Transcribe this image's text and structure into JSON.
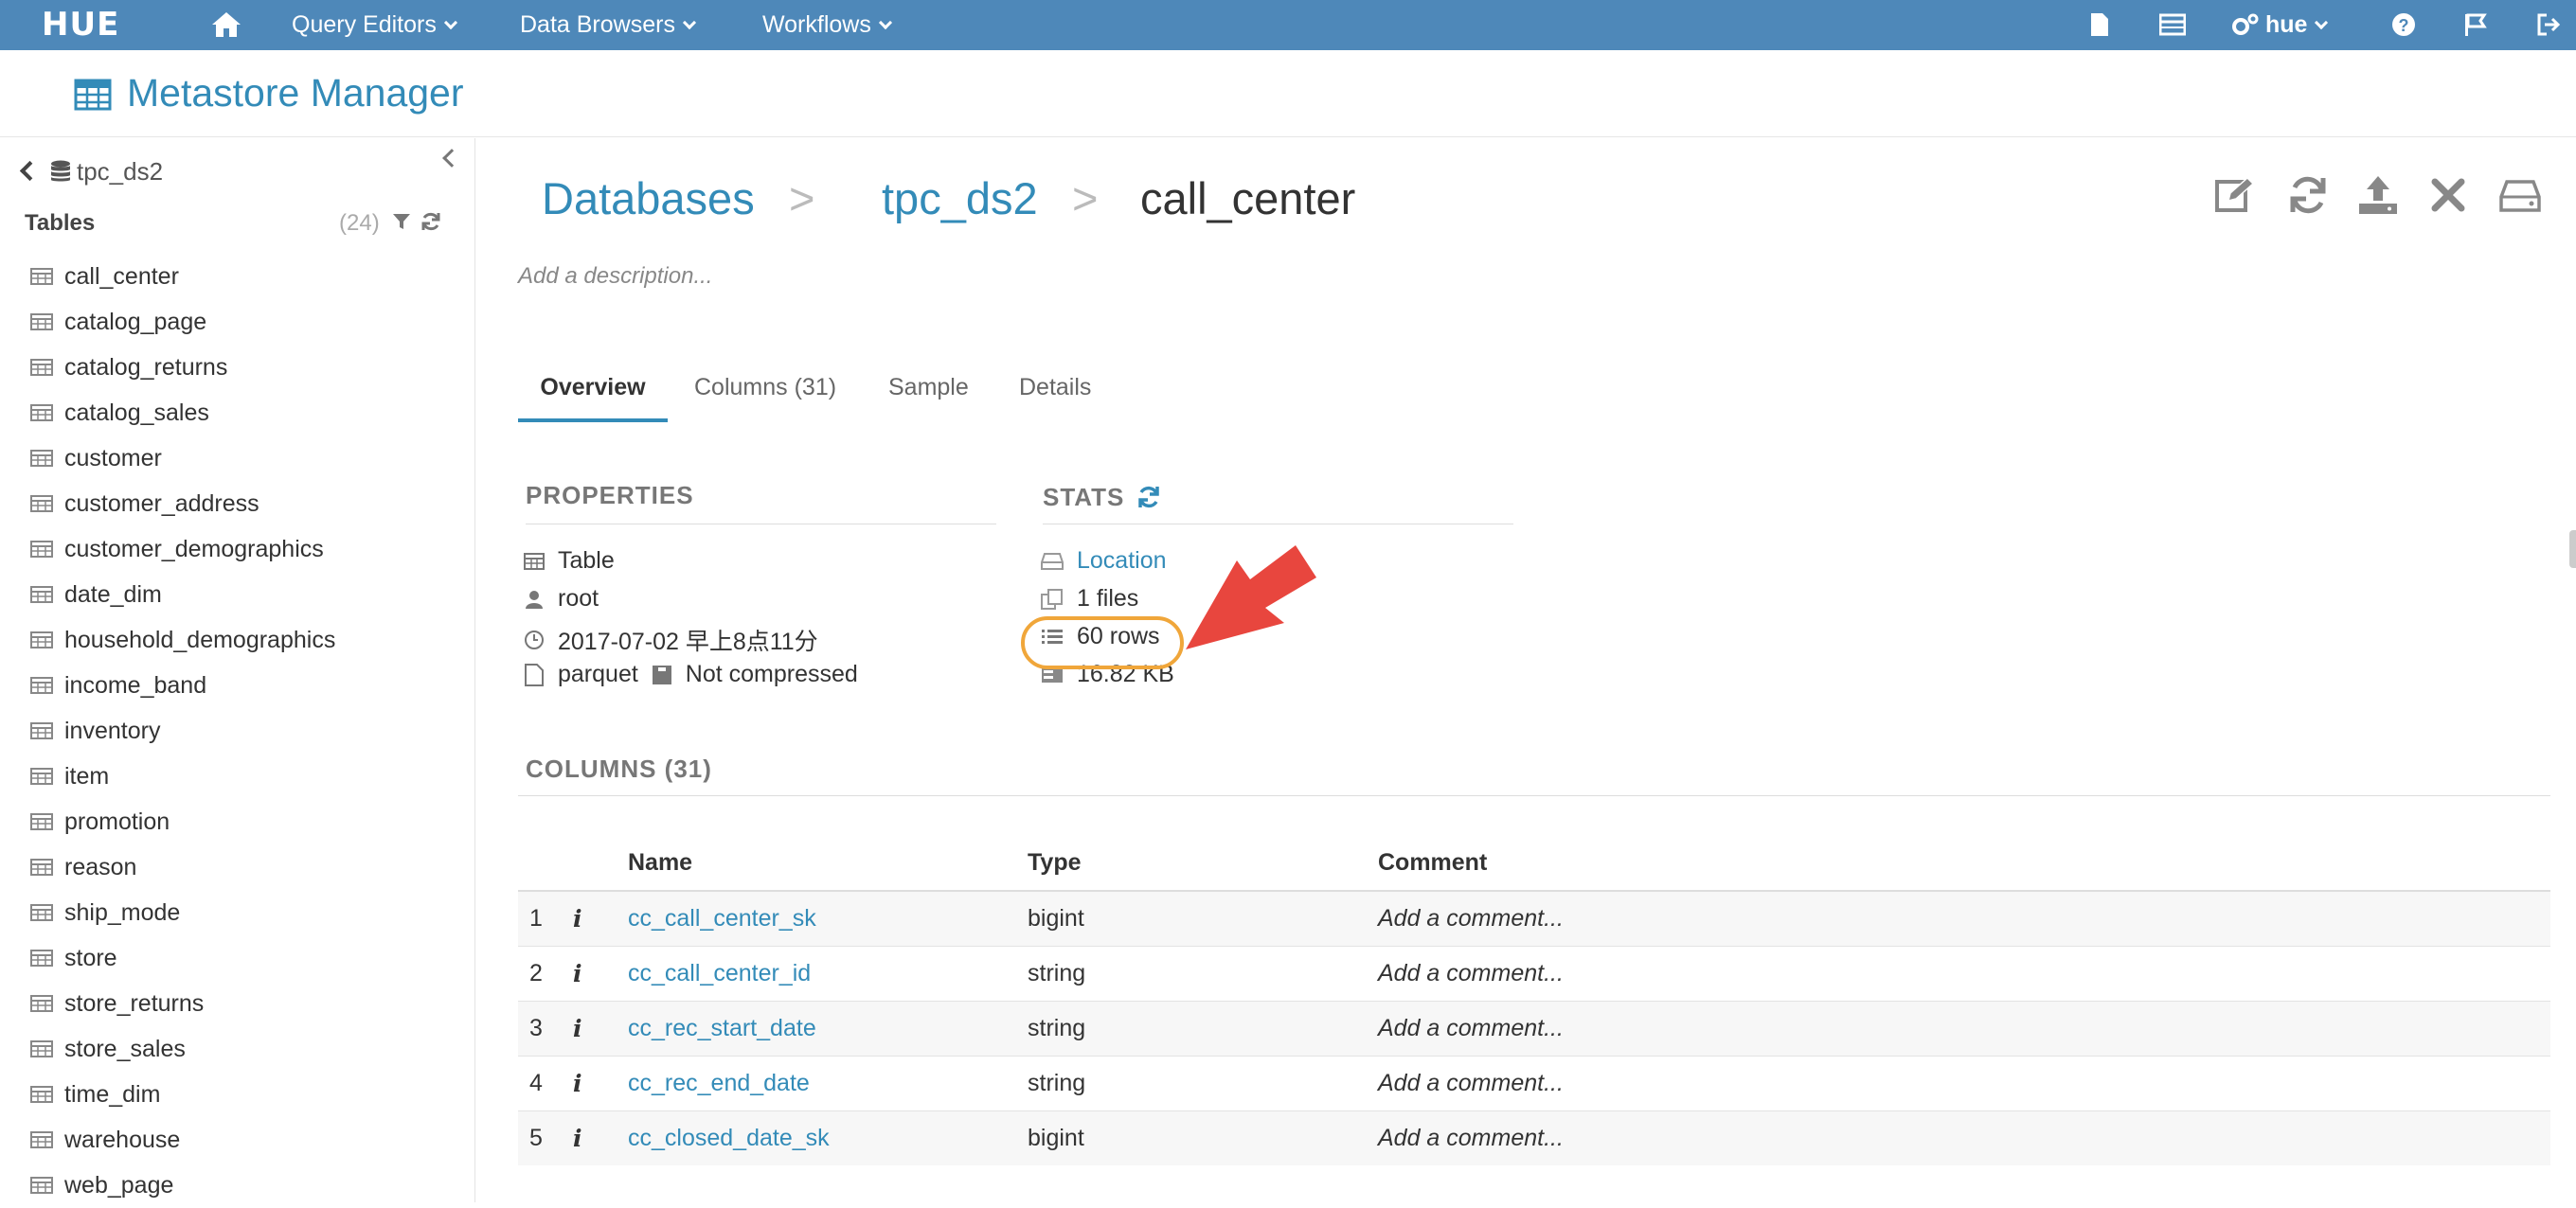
{
  "topbar": {
    "logo": "HUE",
    "home_icon": "home-icon",
    "menus": [
      {
        "label": "Query Editors"
      },
      {
        "label": "Data Browsers"
      },
      {
        "label": "Workflows"
      }
    ],
    "user": "hue",
    "icons": [
      "document-icon",
      "table-browser-icon",
      "gears-icon",
      "help-icon",
      "flag-icon",
      "logout-icon"
    ]
  },
  "header": {
    "title": "Metastore Manager",
    "icon": "table-icon"
  },
  "sidebar": {
    "database": "tpc_ds2",
    "tables_label": "Tables",
    "count": "(24)",
    "tables": [
      "call_center",
      "catalog_page",
      "catalog_returns",
      "catalog_sales",
      "customer",
      "customer_address",
      "customer_demographics",
      "date_dim",
      "household_demographics",
      "income_band",
      "inventory",
      "item",
      "promotion",
      "reason",
      "ship_mode",
      "store",
      "store_returns",
      "store_sales",
      "time_dim",
      "warehouse",
      "web_page"
    ]
  },
  "breadcrumb": {
    "databases": "Databases",
    "sep1": ">",
    "database": "tpc_ds2",
    "sep2": ">",
    "table": "call_center"
  },
  "description_placeholder": "Add a description...",
  "tabs": [
    "Overview",
    "Columns (31)",
    "Sample",
    "Details"
  ],
  "properties": {
    "title": "PROPERTIES",
    "type": "Table",
    "owner": "root",
    "created": "2017-07-02 早上8点11分",
    "format": "parquet",
    "compression": "Not compressed"
  },
  "stats": {
    "title": "STATS",
    "location": "Location",
    "files": "1 files",
    "rows": "60 rows",
    "size": "16.82 KB"
  },
  "columns_section": {
    "title": "COLUMNS (31)",
    "headers": {
      "num": "",
      "info": "",
      "name": "Name",
      "type": "Type",
      "comment": "Comment"
    },
    "rows": [
      {
        "num": "1",
        "info": "i",
        "name": "cc_call_center_sk",
        "type": "bigint",
        "comment": "Add a comment..."
      },
      {
        "num": "2",
        "info": "i",
        "name": "cc_call_center_id",
        "type": "string",
        "comment": "Add a comment..."
      },
      {
        "num": "3",
        "info": "i",
        "name": "cc_rec_start_date",
        "type": "string",
        "comment": "Add a comment..."
      },
      {
        "num": "4",
        "info": "i",
        "name": "cc_rec_end_date",
        "type": "string",
        "comment": "Add a comment..."
      },
      {
        "num": "5",
        "info": "i",
        "name": "cc_closed_date_sk",
        "type": "bigint",
        "comment": "Add a comment..."
      }
    ]
  },
  "colors": {
    "topbar": "#4e88b9",
    "accent": "#338bb8",
    "highlight": "#f0a63a",
    "arrow": "#e8463e"
  }
}
